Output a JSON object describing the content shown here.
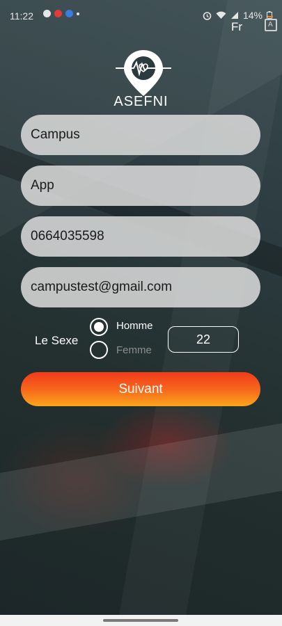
{
  "status_bar": {
    "time": "11:22",
    "battery": "14%",
    "icons_left": [
      "snapchat-icon",
      "app-icon",
      "messenger-icon",
      "dot-icon"
    ],
    "icons_right": [
      "alarm-icon",
      "wifi-icon",
      "signal-icon",
      "battery-icon"
    ]
  },
  "header": {
    "language": "Fr",
    "translate_icon": "translate-icon"
  },
  "brand": {
    "name": "ASEFNI",
    "logo_icon": "location-pin-heartbeat-icon"
  },
  "form": {
    "first_name": "Campus",
    "last_name": "App",
    "phone": "0664035598",
    "email": "campustest@gmail.com",
    "sex_label": "Le Sexe",
    "options": [
      "Homme",
      "Femme"
    ],
    "selected_option": "Homme",
    "age": "22",
    "next_label": "Suivant"
  },
  "colors": {
    "button_gradient_top": "#f23b1b",
    "button_gradient_bottom": "#fba61c",
    "field_bg": "#dcdcdc"
  }
}
